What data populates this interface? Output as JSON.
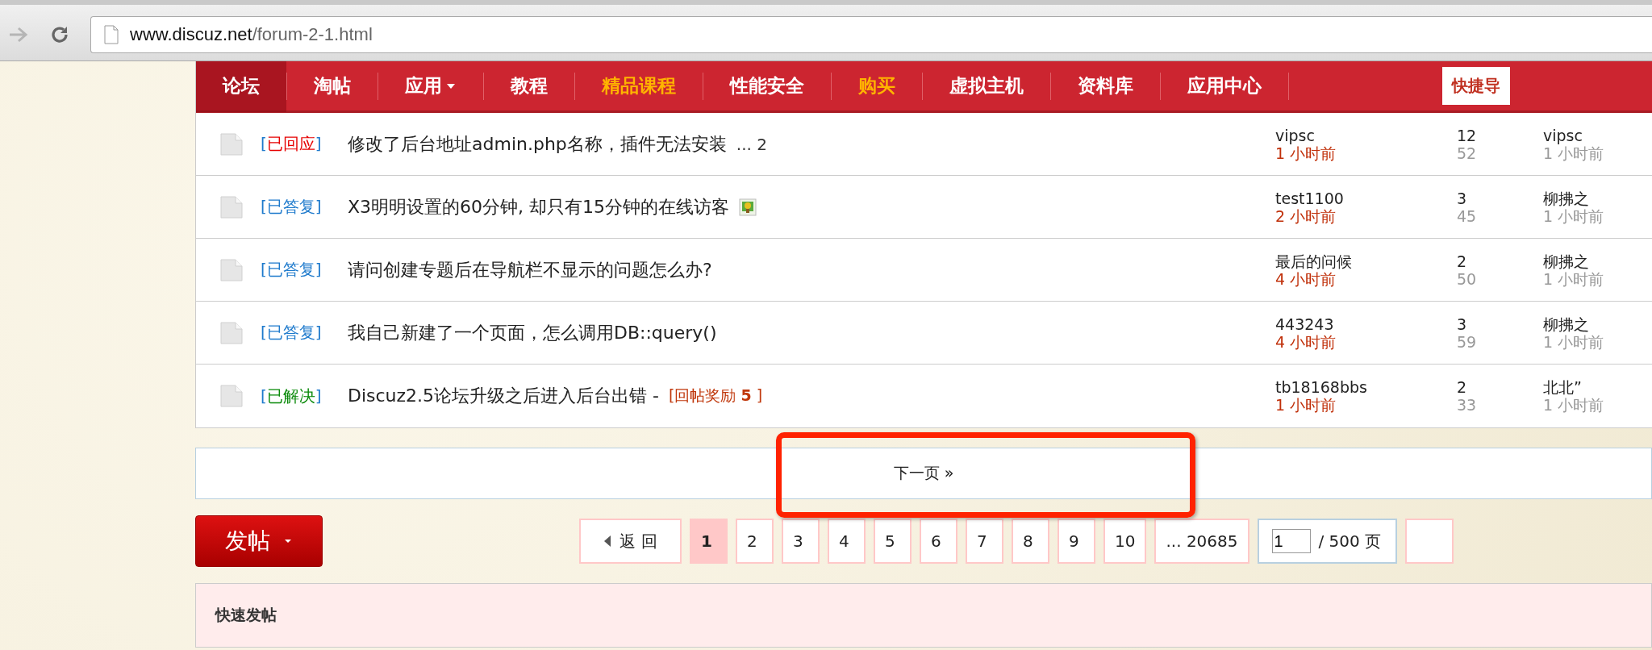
{
  "browser": {
    "url_host": "www.discuz.net",
    "url_path": "/forum-2-1.html"
  },
  "nav": {
    "items": [
      {
        "label": "论坛",
        "selected": true,
        "kind": "normal",
        "has_menu": false
      },
      {
        "label": "淘帖",
        "selected": false,
        "kind": "normal",
        "has_menu": false
      },
      {
        "label": "应用",
        "selected": false,
        "kind": "normal",
        "has_menu": true
      },
      {
        "label": "教程",
        "selected": false,
        "kind": "normal",
        "has_menu": false
      },
      {
        "label": "精品课程",
        "selected": false,
        "kind": "featured",
        "has_menu": false
      },
      {
        "label": "性能安全",
        "selected": false,
        "kind": "normal",
        "has_menu": false
      },
      {
        "label": "购买",
        "selected": false,
        "kind": "featured",
        "has_menu": false
      },
      {
        "label": "虚拟主机",
        "selected": false,
        "kind": "normal",
        "has_menu": false
      },
      {
        "label": "资料库",
        "selected": false,
        "kind": "normal",
        "has_menu": false
      },
      {
        "label": "应用中心",
        "selected": false,
        "kind": "normal",
        "has_menu": false
      }
    ],
    "quick_nav": "快捷导"
  },
  "threads": [
    {
      "tag": "[已回应]",
      "kind": "replied",
      "title": "修改了后台地址admin.php名称，插件无法安装",
      "pages": "... 2",
      "has_image": false,
      "author": "vipsc",
      "time": "1 小时前",
      "replies": "12",
      "views": "52",
      "last_poster": "vipsc",
      "last_time": "1 小时前"
    },
    {
      "tag": "[已答复]",
      "kind": "answered",
      "title": "X3明明设置的60分钟, 却只有15分钟的在线访客",
      "has_image": true,
      "author": "test1100",
      "time": "2 小时前",
      "replies": "3",
      "views": "45",
      "last_poster": "柳拂之",
      "last_time": "1 小时前"
    },
    {
      "tag": "[已答复]",
      "kind": "answered",
      "title": "请问创建专题后在导航栏不显示的问题怎么办?",
      "has_image": false,
      "author": "最后的问候",
      "time": "4 小时前",
      "replies": "2",
      "views": "50",
      "last_poster": "柳拂之",
      "last_time": "1 小时前"
    },
    {
      "tag": "[已答复]",
      "kind": "answered",
      "title": "我自己新建了一个页面，怎么调用DB::query()",
      "has_image": false,
      "author": "443243",
      "time": "4 小时前",
      "replies": "3",
      "views": "59",
      "last_poster": "柳拂之",
      "last_time": "1 小时前"
    },
    {
      "tag": "[已解决]",
      "kind": "solved",
      "title": "Discuz2.5论坛升级之后进入后台出错 -",
      "reward": "[回帖奖励 **5** ]",
      "has_image": false,
      "author": "tb18168bbs",
      "time": "1 小时前",
      "replies": "2",
      "views": "33",
      "last_poster": "北北”",
      "last_time": "1 小时前"
    }
  ],
  "next_page": "下一页 »",
  "post_button": "发帖",
  "pagination": {
    "back": "返 回",
    "pages": [
      {
        "label": "1",
        "selected": true
      },
      {
        "label": "2",
        "selected": false
      },
      {
        "label": "3",
        "selected": false
      },
      {
        "label": "4",
        "selected": false
      },
      {
        "label": "5",
        "selected": false
      },
      {
        "label": "6",
        "selected": false
      },
      {
        "label": "7",
        "selected": false
      },
      {
        "label": "8",
        "selected": false
      },
      {
        "label": "9",
        "selected": false
      },
      {
        "label": "10",
        "selected": false
      },
      {
        "label": "... 20685",
        "selected": false
      }
    ],
    "page_input": "1",
    "total": "/ 500 页"
  },
  "quick_post": "快速发帖"
}
